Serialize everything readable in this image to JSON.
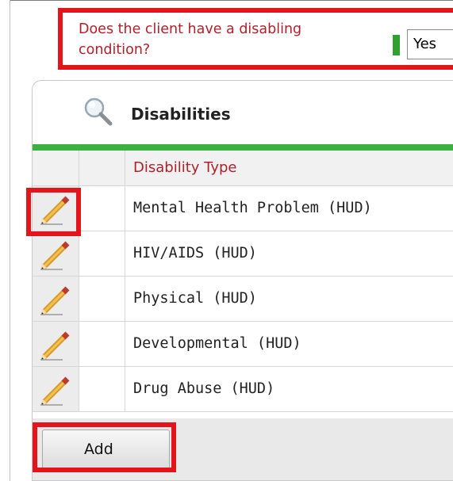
{
  "question": {
    "text": "Does the client have a disabling condition?",
    "answer": "Yes"
  },
  "panel": {
    "title": "Disabilities",
    "column_header": "Disability Type",
    "rows": [
      {
        "type": "Mental Health Problem (HUD)"
      },
      {
        "type": "HIV/AIDS (HUD)"
      },
      {
        "type": "Physical (HUD)"
      },
      {
        "type": "Developmental (HUD)"
      },
      {
        "type": "Drug Abuse (HUD)"
      }
    ],
    "add_label": "Add"
  },
  "colors": {
    "highlight": "#e3141a",
    "accent_green": "#3cb043",
    "label_red": "#b0212c"
  },
  "icons": {
    "search": "magnifier-icon",
    "edit": "pencil-icon"
  }
}
